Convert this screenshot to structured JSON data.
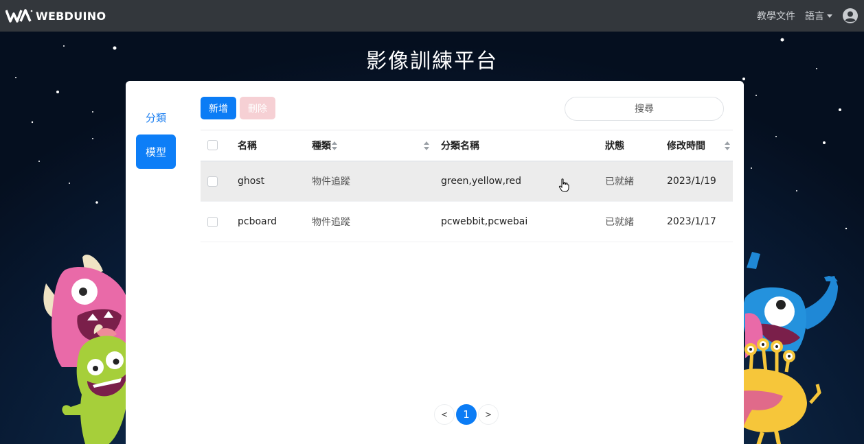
{
  "navbar": {
    "brand": "WEBDUINO",
    "docs": "教學文件",
    "language": "語言"
  },
  "page": {
    "title": "影像訓練平台"
  },
  "sidebar": {
    "items": [
      {
        "label": "分類",
        "active": false
      },
      {
        "label": "模型",
        "active": true
      }
    ]
  },
  "toolbar": {
    "add_label": "新增",
    "delete_label": "刪除",
    "search_placeholder": "搜尋"
  },
  "table": {
    "headers": [
      "名稱",
      "種類",
      "分類名稱",
      "狀態",
      "修改時間"
    ],
    "rows": [
      {
        "name": "ghost",
        "type": "物件追蹤",
        "classes": "green,yellow,red",
        "status": "已就緒",
        "modified": "2023/1/19"
      },
      {
        "name": "pcboard",
        "type": "物件追蹤",
        "classes": "pcwebbit,pcwebai",
        "status": "已就緒",
        "modified": "2023/1/17"
      }
    ]
  },
  "pagination": {
    "prev": "<",
    "current": "1",
    "next": ">"
  },
  "colors": {
    "primary": "#0b7cf5",
    "navbar": "#33373c",
    "delete_disabled": "#f6d0d4"
  }
}
